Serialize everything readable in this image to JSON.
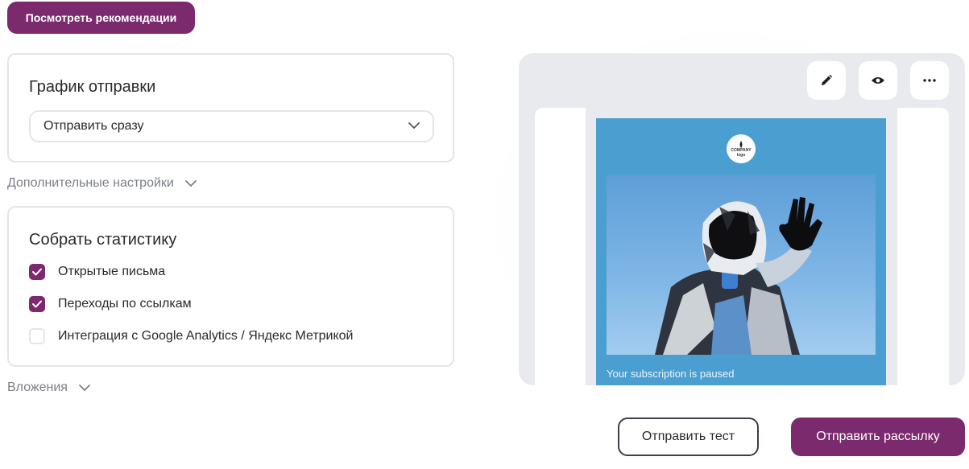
{
  "top_button": {
    "label": "Посмотреть рекомендации"
  },
  "schedule": {
    "title": "График отправки",
    "select_value": "Отправить сразу"
  },
  "advanced": {
    "label": "Дополнительные настройки"
  },
  "stats": {
    "title": "Собрать статистику",
    "options": [
      {
        "label": "Открытые письма",
        "checked": true
      },
      {
        "label": "Переходы по ссылкам",
        "checked": true
      },
      {
        "label": "Интеграция с Google Analytics / Яндекс Метрикой",
        "checked": false
      }
    ]
  },
  "attachments": {
    "label": "Вложения"
  },
  "preview": {
    "logo_line1": "COMPANY",
    "logo_line2": "logo",
    "email_text": "Your subscription is paused"
  },
  "actions": {
    "send_test": "Отправить тест",
    "send_campaign": "Отправить рассылку"
  },
  "colors": {
    "brand": "#7c2a6e",
    "email_bg": "#4a9fd0"
  }
}
